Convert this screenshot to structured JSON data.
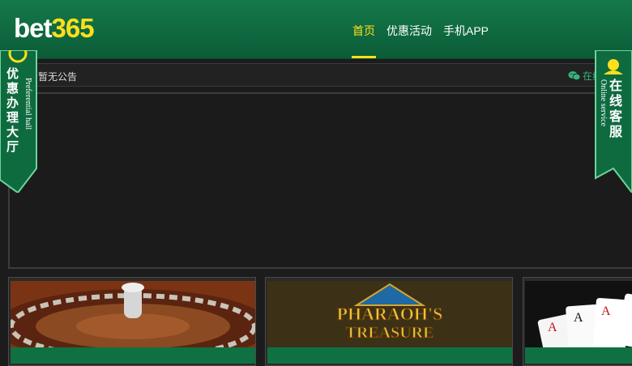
{
  "brand": {
    "logo_part1": "bet",
    "logo_part2": "365"
  },
  "nav": {
    "items": [
      "首页",
      "优惠活动",
      "手机APP"
    ],
    "active": "首页"
  },
  "notice": {
    "text": "暂无公告",
    "service_label": "在线"
  },
  "side_left": {
    "cn": [
      "优",
      "惠",
      "办",
      "理",
      "大",
      "厅"
    ],
    "en": "Preferential hall"
  },
  "side_right": {
    "cn": [
      "在",
      "线",
      "客",
      "服"
    ],
    "en": "Online  service"
  },
  "games": [
    {
      "title": "",
      "image": "roulette-image"
    },
    {
      "title": "",
      "image": "pharaohs-treasure-image",
      "image_text_1": "PHARAOH'S",
      "image_text_2": "TREASURE"
    },
    {
      "title": "",
      "image": "playing-cards-image",
      "image_cards": [
        "A",
        "A",
        "A"
      ]
    }
  ],
  "colors": {
    "header_green": "#0b5c37",
    "accent_yellow": "#ffdf1b",
    "title_green": "#0f7142",
    "wechat_green": "#36b37e"
  }
}
